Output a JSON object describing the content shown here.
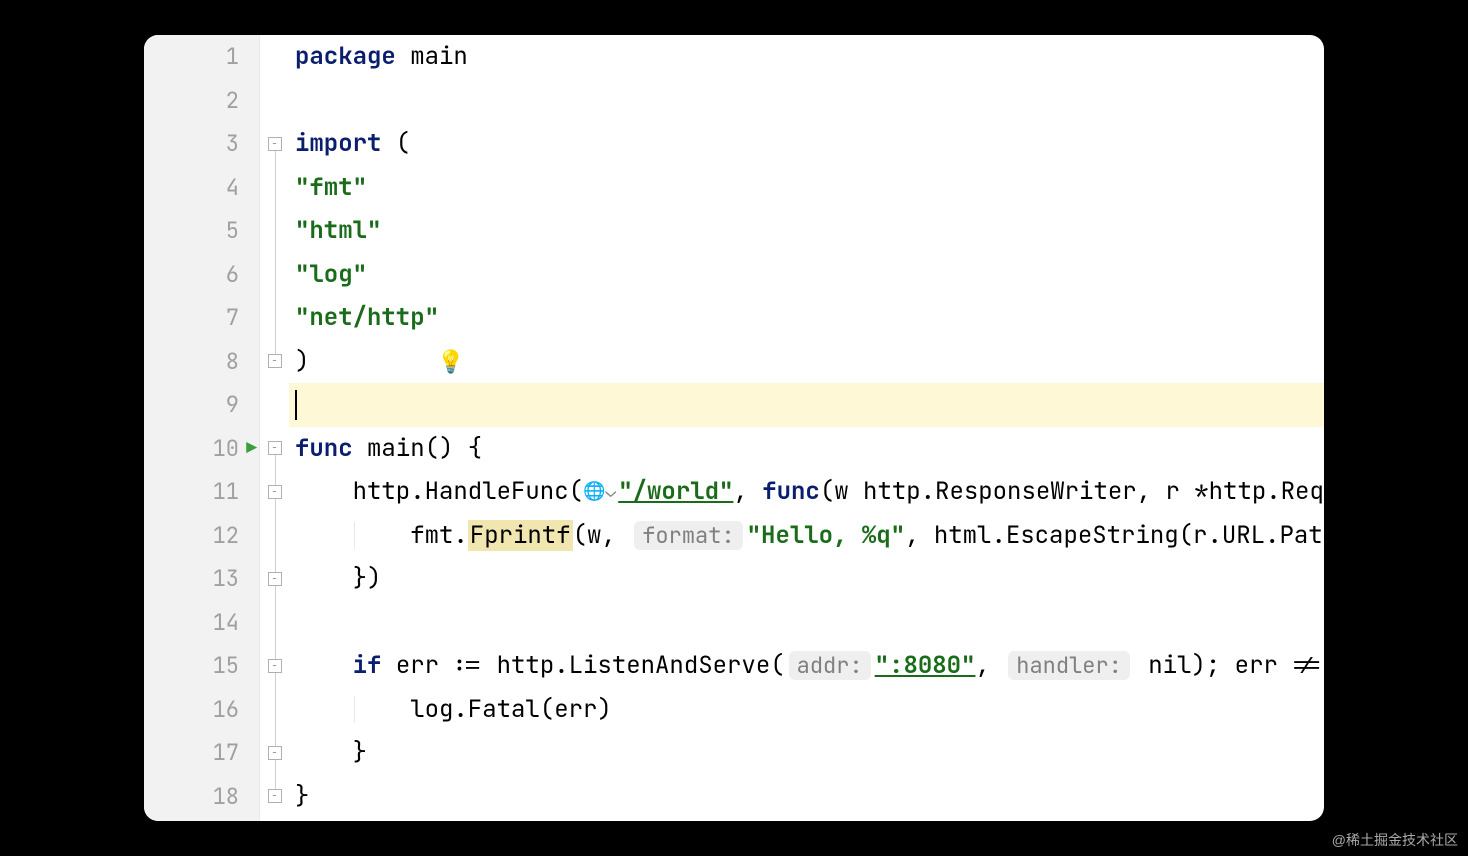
{
  "watermark": "@稀土掘金技术社区",
  "lines": {
    "count": 18,
    "cursor_line": 9,
    "run_line": 10
  },
  "fold_markers": {
    "3": "open-start",
    "8": "open-end",
    "10": "open-start",
    "11": "open-start",
    "13": "open-end",
    "15": "open-start",
    "17": "open-end",
    "18": "open-end"
  },
  "code": {
    "l1_kw": "package",
    "l1_rest": " main",
    "l3_kw": "import",
    "l3_rest": " (",
    "l4_str": "\"fmt\"",
    "l5_str": "\"html\"",
    "l6_str": "\"log\"",
    "l7_str": "\"net/http\"",
    "l8": ")",
    "l10_kw": "func",
    "l10_rest": " main() {",
    "l11_pre": "    http.HandleFunc(",
    "l11_url": "\"/world\"",
    "l11_mid": ", ",
    "l11_kw": "func",
    "l11_post": "(w http.ResponseWriter, r *http.Request) {",
    "l12_pre": "        fmt.",
    "l12_func": "Fprintf",
    "l12_mid1": "(w, ",
    "l12_hint": "format:",
    "l12_str": "\"Hello, %q\"",
    "l12_post": ", html.EscapeString(r.URL.Path))",
    "l13": "    })",
    "l15_pre": "    ",
    "l15_kw": "if",
    "l15_mid1": " err := http.ListenAndServe(",
    "l15_hint1": "addr:",
    "l15_addr": "\":8080\"",
    "l15_mid2": ", ",
    "l15_hint2": "handler:",
    "l15_post": " nil); err != nil {",
    "l16": "        log.Fatal(err)",
    "l17": "    }",
    "l18": "}"
  },
  "icons": {
    "bulb": "💡",
    "globe": "🌐⌄",
    "play": "▶"
  }
}
